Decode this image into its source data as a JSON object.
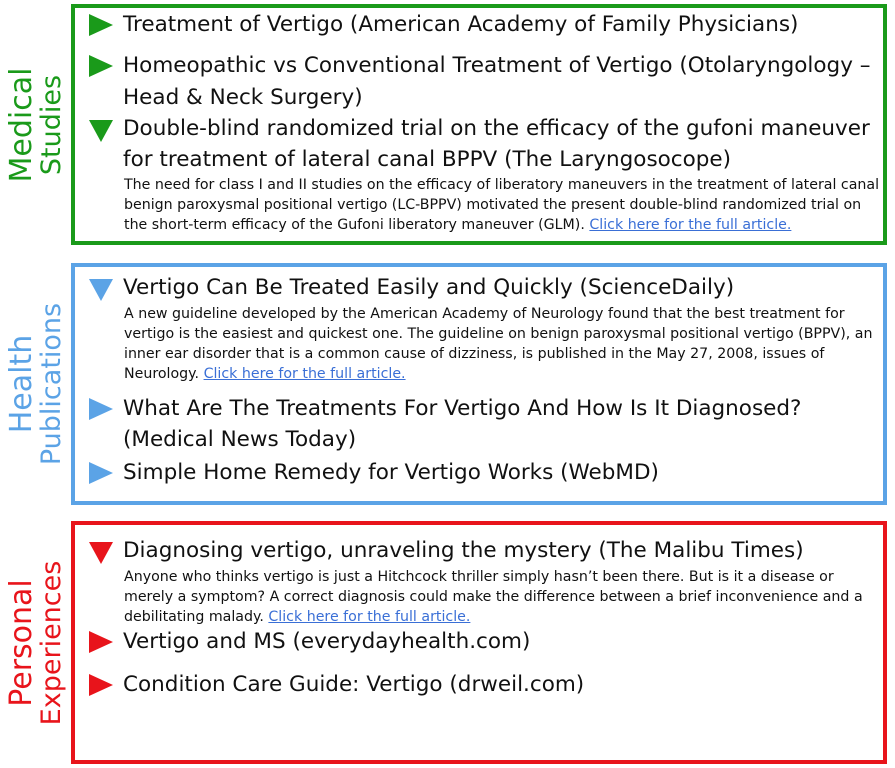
{
  "sections": {
    "medical": {
      "label_line1": "Medical",
      "label_line2": "Studies",
      "items": [
        {
          "title_line1": "Treatment of Vertigo (American Academy of Family Physicians)"
        },
        {
          "title_line1": "Homeopathic vs Conventional Treatment of Vertigo (Otolaryngology –",
          "title_line2": "Head & Neck Surgery)"
        },
        {
          "title_line1": "Double-blind randomized trial on the efficacy of the gufoni maneuver",
          "title_line2": "for treatment of lateral canal BPPV (The Laryngosocope)",
          "summary": "The need for class I and II studies on the efficacy of liberatory maneuvers in the treatment of lateral canal benign paroxysmal positional vertigo (LC-BPPV) motivated the present double-blind randomized trial on the short-term efficacy of the Gufoni liberatory maneuver (GLM).",
          "link": "Click here for the full article."
        }
      ]
    },
    "health": {
      "label_line1": "Health",
      "label_line2": "Publications",
      "items": [
        {
          "title_line1": "Vertigo Can Be Treated Easily and Quickly (ScienceDaily)",
          "summary": "A new guideline developed by the American Academy of Neurology found that the best treatment for vertigo is the easiest and quickest one. The guideline on benign paroxysmal positional vertigo (BPPV), an inner ear disorder that is a common cause of dizziness, is published in the May 27, 2008, issues of Neurology.",
          "link": "Click here for the full article."
        },
        {
          "title_line1": "What Are The Treatments For Vertigo And How Is It Diagnosed?",
          "title_line2": "(Medical News Today)"
        },
        {
          "title_line1": "Simple Home Remedy for Vertigo Works (WebMD)"
        }
      ]
    },
    "personal": {
      "label_line1": "Personal",
      "label_line2": "Experiences",
      "items": [
        {
          "title_line1": "Diagnosing vertigo, unraveling the mystery (The Malibu Times)",
          "summary": "Anyone who thinks vertigo is just a Hitchcock thriller simply hasn’t been there. But is it a disease or merely a symptom? A correct diagnosis could make the difference between a brief inconvenience and a debilitating malady.",
          "link": "Click here for the full article."
        },
        {
          "title_line1": "Vertigo and MS (everydayhealth.com)"
        },
        {
          "title_line1": "Condition Care Guide: Vertigo (drweil.com)"
        }
      ]
    }
  },
  "colors": {
    "medical": "#1a9a1a",
    "health": "#5ba3e6",
    "personal": "#e8141b",
    "link": "#3a6fd6"
  },
  "icons": {
    "collapsed": "triangle-right-icon",
    "expanded": "triangle-down-icon"
  }
}
